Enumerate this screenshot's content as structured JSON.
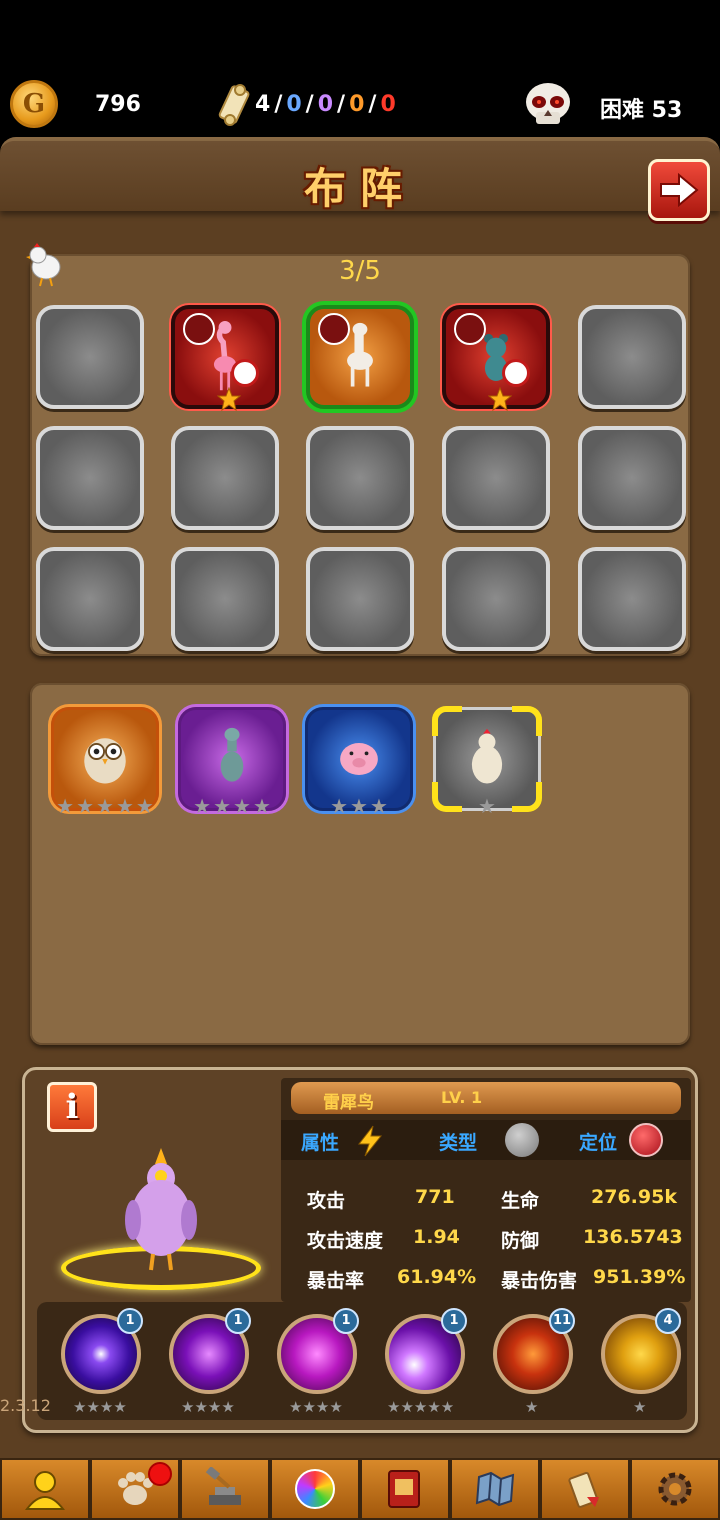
{
  "topbar": {
    "gold": "796",
    "scroll_counts": [
      "4",
      "0",
      "0",
      "0",
      "0"
    ],
    "scroll_colors": [
      "#ffffff",
      "#6aa8ff",
      "#c98aff",
      "#ff9a2a",
      "#ff3a2a"
    ],
    "separator": "/",
    "difficulty": "困难 53"
  },
  "panel": {
    "title": "布阵",
    "team_count": "3/5"
  },
  "grid": {
    "slots": [
      {
        "state": "empty"
      },
      {
        "state": "red",
        "pet": "flamingo",
        "locked": true
      },
      {
        "state": "orange",
        "pet": "llama",
        "locked": false
      },
      {
        "state": "red",
        "pet": "bear",
        "locked": true
      },
      {
        "state": "empty"
      },
      {
        "state": "empty"
      },
      {
        "state": "empty"
      },
      {
        "state": "empty"
      },
      {
        "state": "empty"
      },
      {
        "state": "empty"
      },
      {
        "state": "empty"
      },
      {
        "state": "empty"
      },
      {
        "state": "empty"
      },
      {
        "state": "empty"
      },
      {
        "state": "empty"
      }
    ]
  },
  "bench": {
    "cards": [
      {
        "pet": "owl",
        "frame": "orange",
        "stars": 5
      },
      {
        "pet": "donkey",
        "frame": "purple",
        "stars": 4
      },
      {
        "pet": "pig",
        "frame": "blue",
        "stars": 3
      },
      {
        "pet": "chicken",
        "frame": "gray",
        "stars": 1,
        "selected": true
      }
    ]
  },
  "info": {
    "name": "雷犀鸟",
    "level": "LV.  1",
    "attr_labels": [
      "属性",
      "类型",
      "定位"
    ],
    "stats": [
      {
        "key": "攻击",
        "value": "771"
      },
      {
        "key": "生命",
        "value": "276.95k"
      },
      {
        "key": "攻击速度",
        "value": "1.94"
      },
      {
        "key": "防御",
        "value": "136.5743"
      },
      {
        "key": "暴击率",
        "value": "61.94%"
      },
      {
        "key": "暴击伤害",
        "value": "951.39%"
      }
    ],
    "skills": [
      {
        "level": "1",
        "stars": 4,
        "color": "#6a2ae0"
      },
      {
        "level": "1",
        "stars": 4,
        "color": "#9a1fc0"
      },
      {
        "level": "1",
        "stars": 4,
        "color": "#c02ac8"
      },
      {
        "level": "1",
        "stars": 5,
        "color": "#8a2ad0"
      },
      {
        "level": "11",
        "stars": 1,
        "color": "#c8320e"
      },
      {
        "level": "4",
        "stars": 1,
        "color": "#e0a010"
      }
    ]
  },
  "version": "2.3.12",
  "nav": [
    "profile-icon",
    "pet-paw-icon",
    "forge-icon",
    "orb-icon",
    "book-icon",
    "map-icon",
    "scroll-icon",
    "gear-icon"
  ]
}
